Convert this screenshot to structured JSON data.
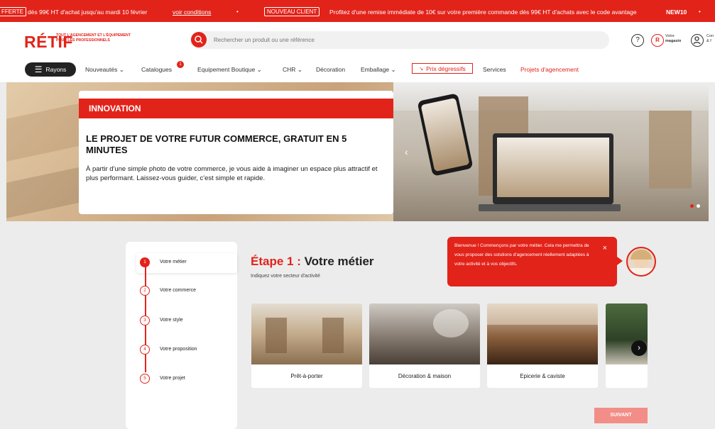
{
  "promo": {
    "pill_left": "FFERTE",
    "text_left": "dès 99€ HT d'achat jusqu'au mardi 10 février",
    "link": "voir conditions",
    "pill_right": "NOUVEAU CLIENT",
    "text_right": "Profitez d'une remise immédiate de 10€ sur votre première commande dès 99€ HT d'achats avec le code avantage",
    "code": "NEW10"
  },
  "header": {
    "logo": "RÉTIF",
    "tagline_1": "TOUT L'AGENCEMENT ET L'ÉQUIPEMENT",
    "tagline_2": "POUR LES PROFESSIONNELS",
    "search_placeholder": "Rechercher un produit ou une référence",
    "store_label_1": "Votre",
    "store_label_2": "magasin",
    "account_label_1": "Con",
    "account_label_2": "& f"
  },
  "nav": {
    "rayons": "Rayons",
    "items": [
      "Nouveautés",
      "Catalogues",
      "Equipement Boutique",
      "CHR",
      "Décoration",
      "Emballage",
      "Prix dégressifs",
      "Services",
      "Projets d'agencement"
    ],
    "catalogues_badge": "1"
  },
  "hero": {
    "tag": "INNOVATION",
    "title": "LE PROJET DE VOTRE FUTUR COMMERCE, GRATUIT EN 5 MINUTES",
    "text": "À partir d'une simple photo de votre commerce, je vous aide à imaginer un espace plus attractif et plus performant. Laissez-vous guider, c'est simple et rapide.",
    "slides_total": 2,
    "slide_active": 1
  },
  "stepper": {
    "steps": [
      {
        "num": "1",
        "label": "Votre métier"
      },
      {
        "num": "2",
        "label": "Votre commerce"
      },
      {
        "num": "3",
        "label": "Votre style"
      },
      {
        "num": "4",
        "label": "Votre proposition"
      },
      {
        "num": "5",
        "label": "Votre projet"
      }
    ]
  },
  "main": {
    "etape_label": "Étape 1 :",
    "etape_title": "Votre métier",
    "subtitle": "Indiquez votre secteur d'activité",
    "bubble": "Bienvenue ! Commençons par votre métier. Cela me permettra de vous proposer des solutions d'agencement réellement adaptées à votre activité et à vos objectifs.",
    "cards": [
      "Prêt-à-porter",
      "Décoration & maison",
      "Epicerie & caviste"
    ],
    "next_button": "SUIVANT"
  },
  "colors": {
    "accent": "#e2231a",
    "dark": "#222222",
    "suivant_disabled": "#f28d87"
  }
}
